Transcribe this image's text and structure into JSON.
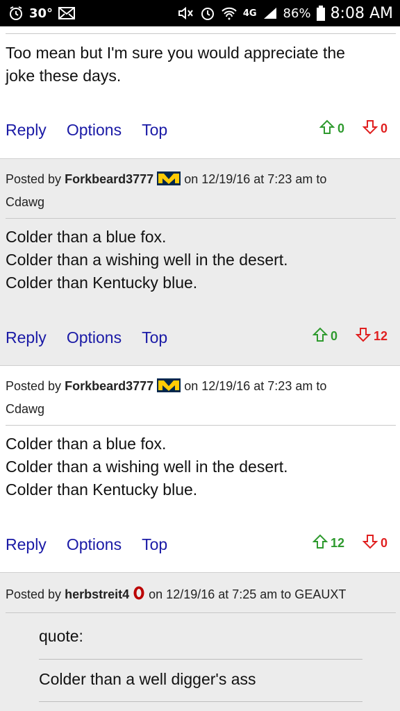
{
  "status_bar": {
    "temperature": "30°",
    "network": "4G",
    "battery": "86%",
    "time": "8:08 AM",
    "icons": [
      "alarm-icon",
      "mail-icon",
      "mute-icon",
      "alarm-clock-icon",
      "wifi-icon",
      "signal-icon",
      "battery-icon"
    ]
  },
  "posts": [
    {
      "body": [
        "Too mean but I'm sure you would appreciate the",
        "joke these days."
      ],
      "actions": {
        "reply": "Reply",
        "options": "Options",
        "top": "Top"
      },
      "upvotes": "0",
      "downvotes": "0"
    },
    {
      "posted_by_label": "Posted by",
      "user": "Forkbeard3777",
      "meta_rest": "on 12/19/16 at 7:23 am to",
      "reply_to": "Cdawg",
      "badge": "michigan-logo",
      "body": [
        "Colder than a blue fox.",
        "Colder than a wishing well in the desert.",
        "Colder than Kentucky blue."
      ],
      "actions": {
        "reply": "Reply",
        "options": "Options",
        "top": "Top"
      },
      "upvotes": "0",
      "downvotes": "12"
    },
    {
      "posted_by_label": "Posted by",
      "user": "Forkbeard3777",
      "meta_rest": "on 12/19/16 at 7:23 am to",
      "reply_to": "Cdawg",
      "badge": "michigan-logo",
      "body": [
        "Colder than a blue fox.",
        "Colder than a wishing well in the desert.",
        "Colder than Kentucky blue."
      ],
      "actions": {
        "reply": "Reply",
        "options": "Options",
        "top": "Top"
      },
      "upvotes": "12",
      "downvotes": "0"
    },
    {
      "posted_by_label": "Posted by",
      "user": "herbstreit4",
      "meta_rest": "on 12/19/16 at 7:25 am to GEAUXT",
      "badge": "ohio-state-logo",
      "quote_label": "quote:",
      "quote_text": "Colder than a well digger's ass"
    }
  ],
  "colors": {
    "up": "#2e9a2e",
    "down": "#e02020",
    "link": "#1a1aa6",
    "gray_bg": "#ececec"
  }
}
